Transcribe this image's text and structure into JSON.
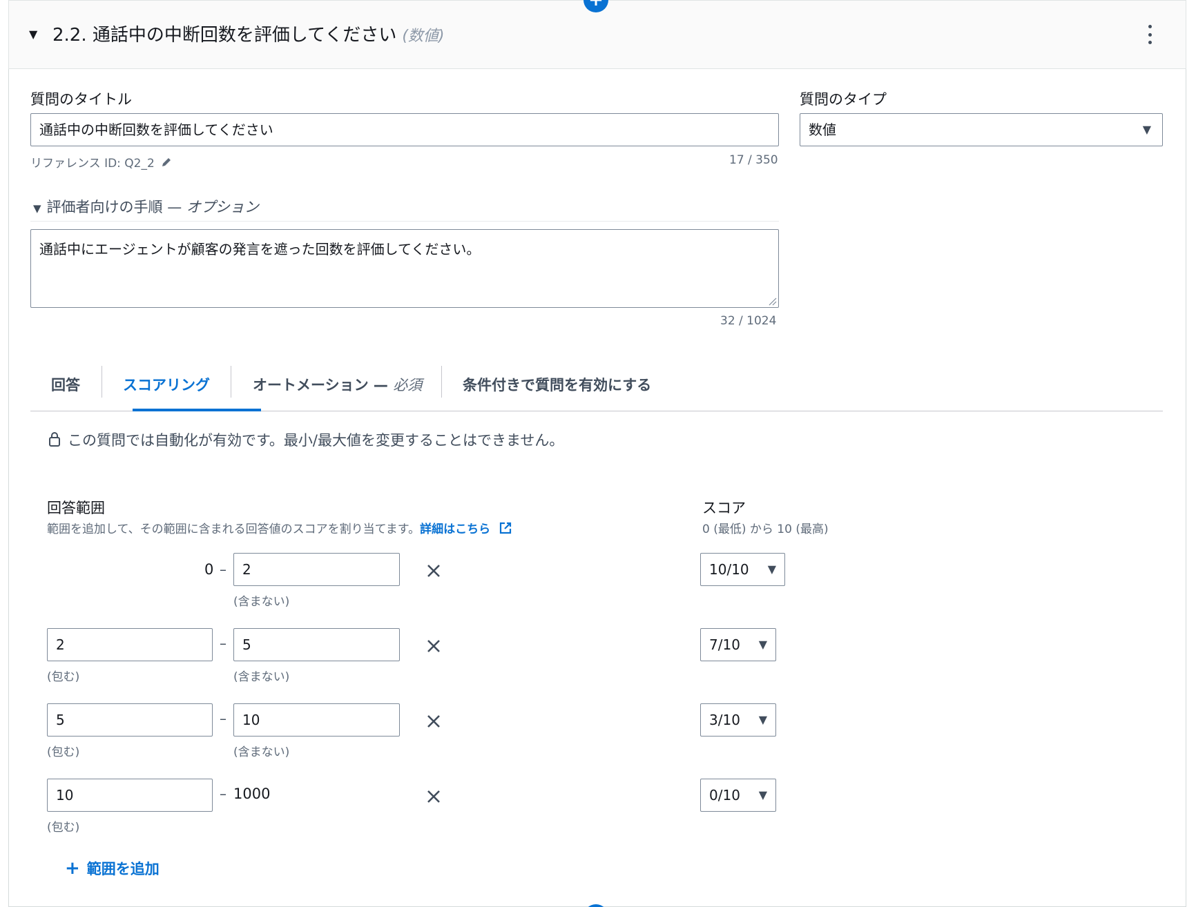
{
  "header": {
    "title": "2.2. 通話中の中断回数を評価してください",
    "type_hint": "(数値)"
  },
  "question_title": {
    "label": "質問のタイトル",
    "value": "通話中の中断回数を評価してください",
    "reference": "リファレンス ID: Q2_2",
    "counter": "17 / 350"
  },
  "question_type": {
    "label": "質問のタイプ",
    "value": "数値"
  },
  "instructions": {
    "label": "評価者向けの手順 — ",
    "optional": "オプション",
    "value": "通話中にエージェントが顧客の発言を遮った回数を評価してください。",
    "counter": "32 / 1024"
  },
  "tabs": [
    {
      "label": "回答"
    },
    {
      "label": "スコアリング"
    },
    {
      "label": "オートメーション — ",
      "suffix": "必須"
    },
    {
      "label": "条件付きで質問を有効にする"
    }
  ],
  "automation_notice": "この質問では自動化が有効です。最小/最大値を変更することはできません。",
  "ranges": {
    "label": "回答範囲",
    "desc": "範囲を追加して、その範囲に含まれる回答値のスコアを割り当てます。",
    "link": "詳細はこちら",
    "rows": [
      {
        "min": "0",
        "max": "2",
        "score": "10/10"
      },
      {
        "min": "2",
        "max": "5",
        "score": "7/10"
      },
      {
        "min": "5",
        "max": "10",
        "score": "3/10"
      },
      {
        "min": "10",
        "max": "1000",
        "score": "0/10"
      }
    ],
    "dash": "–",
    "inclusive": "(包む)",
    "exclusive": "(含まない)",
    "add_label": "範囲を追加"
  },
  "score": {
    "label": "スコア",
    "desc": "0 (最低) から 10 (最高)"
  }
}
